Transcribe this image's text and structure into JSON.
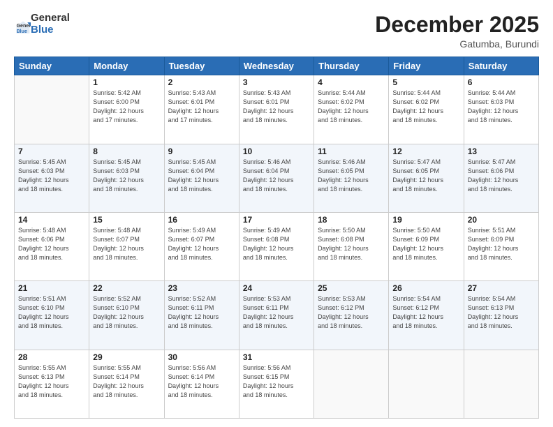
{
  "logo": {
    "general": "General",
    "blue": "Blue"
  },
  "header": {
    "month": "December 2025",
    "location": "Gatumba, Burundi"
  },
  "weekdays": [
    "Sunday",
    "Monday",
    "Tuesday",
    "Wednesday",
    "Thursday",
    "Friday",
    "Saturday"
  ],
  "weeks": [
    [
      {
        "day": "",
        "info": ""
      },
      {
        "day": "1",
        "info": "Sunrise: 5:42 AM\nSunset: 6:00 PM\nDaylight: 12 hours\nand 17 minutes."
      },
      {
        "day": "2",
        "info": "Sunrise: 5:43 AM\nSunset: 6:01 PM\nDaylight: 12 hours\nand 17 minutes."
      },
      {
        "day": "3",
        "info": "Sunrise: 5:43 AM\nSunset: 6:01 PM\nDaylight: 12 hours\nand 18 minutes."
      },
      {
        "day": "4",
        "info": "Sunrise: 5:44 AM\nSunset: 6:02 PM\nDaylight: 12 hours\nand 18 minutes."
      },
      {
        "day": "5",
        "info": "Sunrise: 5:44 AM\nSunset: 6:02 PM\nDaylight: 12 hours\nand 18 minutes."
      },
      {
        "day": "6",
        "info": "Sunrise: 5:44 AM\nSunset: 6:03 PM\nDaylight: 12 hours\nand 18 minutes."
      }
    ],
    [
      {
        "day": "7",
        "info": "Sunrise: 5:45 AM\nSunset: 6:03 PM\nDaylight: 12 hours\nand 18 minutes."
      },
      {
        "day": "8",
        "info": "Sunrise: 5:45 AM\nSunset: 6:03 PM\nDaylight: 12 hours\nand 18 minutes."
      },
      {
        "day": "9",
        "info": "Sunrise: 5:45 AM\nSunset: 6:04 PM\nDaylight: 12 hours\nand 18 minutes."
      },
      {
        "day": "10",
        "info": "Sunrise: 5:46 AM\nSunset: 6:04 PM\nDaylight: 12 hours\nand 18 minutes."
      },
      {
        "day": "11",
        "info": "Sunrise: 5:46 AM\nSunset: 6:05 PM\nDaylight: 12 hours\nand 18 minutes."
      },
      {
        "day": "12",
        "info": "Sunrise: 5:47 AM\nSunset: 6:05 PM\nDaylight: 12 hours\nand 18 minutes."
      },
      {
        "day": "13",
        "info": "Sunrise: 5:47 AM\nSunset: 6:06 PM\nDaylight: 12 hours\nand 18 minutes."
      }
    ],
    [
      {
        "day": "14",
        "info": "Sunrise: 5:48 AM\nSunset: 6:06 PM\nDaylight: 12 hours\nand 18 minutes."
      },
      {
        "day": "15",
        "info": "Sunrise: 5:48 AM\nSunset: 6:07 PM\nDaylight: 12 hours\nand 18 minutes."
      },
      {
        "day": "16",
        "info": "Sunrise: 5:49 AM\nSunset: 6:07 PM\nDaylight: 12 hours\nand 18 minutes."
      },
      {
        "day": "17",
        "info": "Sunrise: 5:49 AM\nSunset: 6:08 PM\nDaylight: 12 hours\nand 18 minutes."
      },
      {
        "day": "18",
        "info": "Sunrise: 5:50 AM\nSunset: 6:08 PM\nDaylight: 12 hours\nand 18 minutes."
      },
      {
        "day": "19",
        "info": "Sunrise: 5:50 AM\nSunset: 6:09 PM\nDaylight: 12 hours\nand 18 minutes."
      },
      {
        "day": "20",
        "info": "Sunrise: 5:51 AM\nSunset: 6:09 PM\nDaylight: 12 hours\nand 18 minutes."
      }
    ],
    [
      {
        "day": "21",
        "info": "Sunrise: 5:51 AM\nSunset: 6:10 PM\nDaylight: 12 hours\nand 18 minutes."
      },
      {
        "day": "22",
        "info": "Sunrise: 5:52 AM\nSunset: 6:10 PM\nDaylight: 12 hours\nand 18 minutes."
      },
      {
        "day": "23",
        "info": "Sunrise: 5:52 AM\nSunset: 6:11 PM\nDaylight: 12 hours\nand 18 minutes."
      },
      {
        "day": "24",
        "info": "Sunrise: 5:53 AM\nSunset: 6:11 PM\nDaylight: 12 hours\nand 18 minutes."
      },
      {
        "day": "25",
        "info": "Sunrise: 5:53 AM\nSunset: 6:12 PM\nDaylight: 12 hours\nand 18 minutes."
      },
      {
        "day": "26",
        "info": "Sunrise: 5:54 AM\nSunset: 6:12 PM\nDaylight: 12 hours\nand 18 minutes."
      },
      {
        "day": "27",
        "info": "Sunrise: 5:54 AM\nSunset: 6:13 PM\nDaylight: 12 hours\nand 18 minutes."
      }
    ],
    [
      {
        "day": "28",
        "info": "Sunrise: 5:55 AM\nSunset: 6:13 PM\nDaylight: 12 hours\nand 18 minutes."
      },
      {
        "day": "29",
        "info": "Sunrise: 5:55 AM\nSunset: 6:14 PM\nDaylight: 12 hours\nand 18 minutes."
      },
      {
        "day": "30",
        "info": "Sunrise: 5:56 AM\nSunset: 6:14 PM\nDaylight: 12 hours\nand 18 minutes."
      },
      {
        "day": "31",
        "info": "Sunrise: 5:56 AM\nSunset: 6:15 PM\nDaylight: 12 hours\nand 18 minutes."
      },
      {
        "day": "",
        "info": ""
      },
      {
        "day": "",
        "info": ""
      },
      {
        "day": "",
        "info": ""
      }
    ]
  ]
}
